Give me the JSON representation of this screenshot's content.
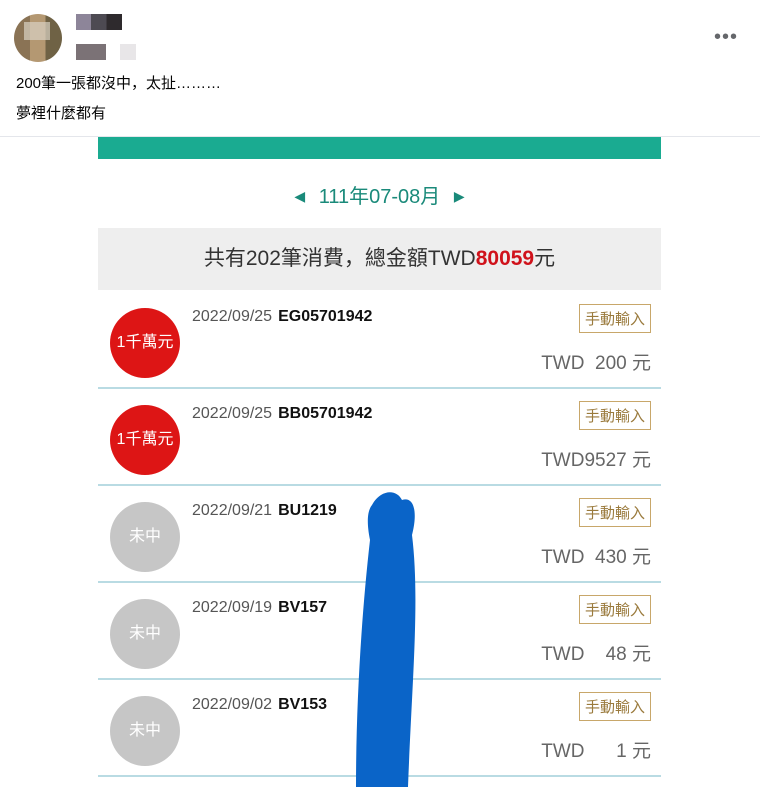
{
  "post": {
    "text_line1": "200筆一張都沒中，太扯………",
    "text_line2": "夢裡什麼都有",
    "more_label": "•••"
  },
  "app": {
    "month_label": "111年07-08月",
    "prev_arrow": "◀",
    "next_arrow": "▶",
    "summary_prefix": "共有202筆消費，總金額TWD",
    "summary_amount": "80059",
    "summary_suffix": "元",
    "rows": [
      {
        "badge": "1千萬元",
        "status": "win",
        "date": "2022/09/25",
        "invoice": "EG05701942",
        "tag": "手動輸入",
        "amount": "TWD  200 元"
      },
      {
        "badge": "1千萬元",
        "status": "win",
        "date": "2022/09/25",
        "invoice": "BB05701942",
        "tag": "手動輸入",
        "amount": "TWD9527 元"
      },
      {
        "badge": "未中",
        "status": "lose",
        "date": "2022/09/21",
        "invoice": "BU1219",
        "tag": "手動輸入",
        "amount": "TWD  430 元"
      },
      {
        "badge": "未中",
        "status": "lose",
        "date": "2022/09/19",
        "invoice": "BV157",
        "tag": "手動輸入",
        "amount": "TWD    48 元"
      },
      {
        "badge": "未中",
        "status": "lose",
        "date": "2022/09/02",
        "invoice": "BV153",
        "tag": "手動輸入",
        "amount": "TWD      1 元"
      }
    ]
  },
  "colors": {
    "accent_green": "#1aab91",
    "win_red": "#dd1515",
    "lose_gray": "#c6c6c6",
    "scribble_blue": "#0a64c8"
  }
}
